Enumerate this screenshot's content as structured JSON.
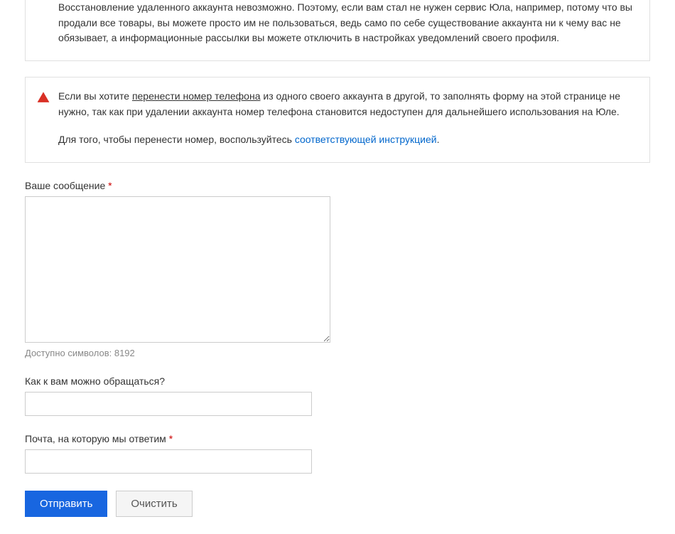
{
  "infoBox1": {
    "text": "Восстановление удаленного аккаунта невозможно. Поэтому, если вам стал не нужен сервис Юла, например, потому что вы продали все товары, вы можете просто им не пользоваться, ведь само по себе существование аккаунта ни к чему вас не обязывает, а информационные рассылки вы можете отключить в настройках уведомлений своего профиля."
  },
  "infoBox2": {
    "part1_before": "Если вы хотите ",
    "part1_underline": "перенести номер телефона",
    "part1_after": " из одного своего аккаунта в другой, то заполнять форму на этой странице не нужно, так как при удалении аккаунта номер телефона становится недоступен для дальнейшего использования на Юле.",
    "part2_before": "Для того, чтобы перенести номер, воспользуйтесь ",
    "part2_link": "соответствующей инструкцией",
    "part2_after": "."
  },
  "form": {
    "message": {
      "label": "Ваше сообщение",
      "value": "",
      "counter": "Доступно символов: 8192"
    },
    "name": {
      "label": "Как к вам можно обращаться?",
      "value": ""
    },
    "email": {
      "label": "Почта, на которую мы ответим",
      "value": ""
    },
    "buttons": {
      "submit": "Отправить",
      "reset": "Очистить"
    }
  },
  "required_marker": " *"
}
